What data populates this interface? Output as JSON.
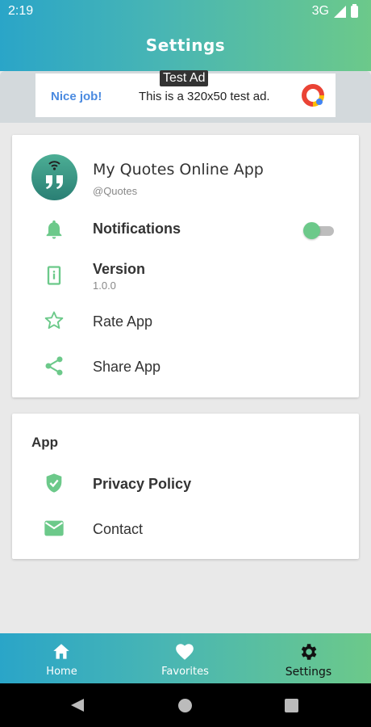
{
  "status_bar": {
    "time": "2:19",
    "network": "3G"
  },
  "header": {
    "title": "Settings"
  },
  "ad": {
    "badge": "Test Ad",
    "nice": "Nice job!",
    "text": "This is a 320x50 test ad."
  },
  "profile": {
    "name": "My Quotes Online App",
    "handle": "@Quotes"
  },
  "settings": {
    "notifications": {
      "label": "Notifications",
      "enabled": true
    },
    "version": {
      "label": "Version",
      "value": "1.0.0"
    },
    "rate": {
      "label": "Rate App"
    },
    "share": {
      "label": "Share App"
    }
  },
  "app_section": {
    "title": "App",
    "privacy": {
      "label": "Privacy Policy"
    },
    "contact": {
      "label": "Contact"
    }
  },
  "bottom_nav": {
    "items": [
      {
        "label": "Home",
        "icon": "home-icon"
      },
      {
        "label": "Favorites",
        "icon": "heart-icon"
      },
      {
        "label": "Settings",
        "icon": "gear-icon",
        "active": true
      }
    ]
  },
  "colors": {
    "accent": "#6cc98a",
    "gradient_start": "#2aa5c8",
    "gradient_end": "#6cc98a"
  }
}
